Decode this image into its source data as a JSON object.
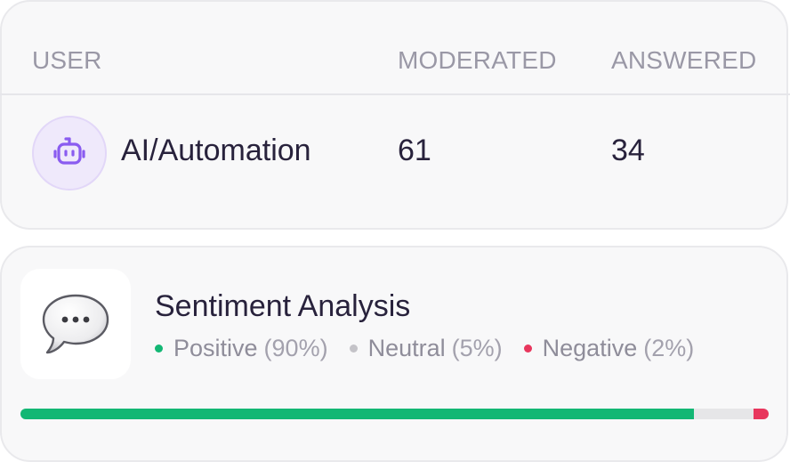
{
  "table": {
    "headers": {
      "user": "USER",
      "moderated": "MODERATED",
      "answered": "ANSWERED"
    },
    "rows": [
      {
        "user": "AI/Automation",
        "avatar_icon": "robot-icon",
        "moderated": "61",
        "answered": "34"
      }
    ]
  },
  "sentiment": {
    "icon": "speech-bubble-icon",
    "title": "Sentiment Analysis",
    "legend": [
      {
        "label": "Positive",
        "pct_text": "(90%)",
        "color": "#13b774"
      },
      {
        "label": "Neutral",
        "pct_text": "(5%)",
        "color": "#c4c3c8"
      },
      {
        "label": "Negative",
        "pct_text": "(2%)",
        "color": "#e8365d"
      }
    ],
    "bar": [
      {
        "name": "positive",
        "fraction": 0.9,
        "color": "#13b774"
      },
      {
        "name": "neutral",
        "fraction": 0.05,
        "color": "#e6e6e8"
      },
      {
        "name": "negative",
        "fraction": 0.02,
        "color": "#e8365d"
      }
    ]
  }
}
